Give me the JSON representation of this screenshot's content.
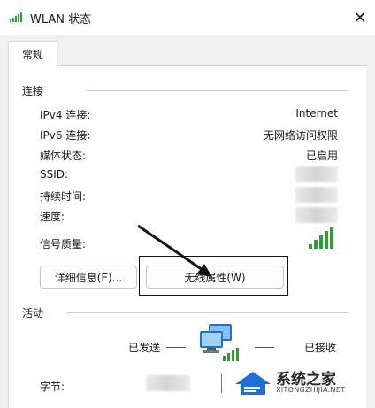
{
  "window": {
    "title": "WLAN 状态",
    "close_glyph": "✕"
  },
  "tabs": [
    {
      "label": "常规"
    }
  ],
  "connection": {
    "section_label": "连接",
    "rows": [
      {
        "label": "IPv4 连接:",
        "value": "Internet"
      },
      {
        "label": "IPv6 连接:",
        "value": "无网络访问权限"
      },
      {
        "label": "媒体状态:",
        "value": "已启用"
      },
      {
        "label": "SSID:",
        "value": ""
      },
      {
        "label": "持续时间:",
        "value": ""
      },
      {
        "label": "速度:",
        "value": ""
      },
      {
        "label": "信号质量:",
        "value": ""
      }
    ],
    "signal_quality_bars": 5
  },
  "buttons": {
    "details": "详细信息(E)...",
    "wireless_properties": "无线属性(W)"
  },
  "activity": {
    "section_label": "活动",
    "sent_label": "已发送",
    "received_label": "已接收",
    "bytes_label": "字节:"
  },
  "watermark": {
    "main": "系统之家",
    "sub": "XITONGZHIJIA.NET"
  },
  "colors": {
    "signal_green": "#2e9e3a",
    "accent_blue": "#1e6fd9"
  }
}
